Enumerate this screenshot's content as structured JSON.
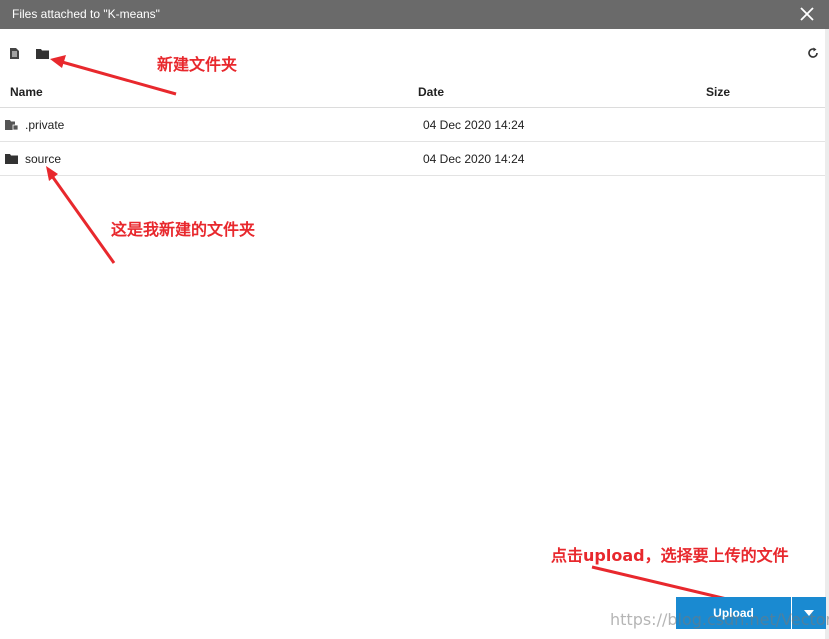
{
  "dialog": {
    "title": "Files attached to \"K-means\""
  },
  "toolbar": {
    "new_file_icon": "new-file-icon",
    "new_folder_icon": "new-folder-icon",
    "refresh_icon": "refresh-icon"
  },
  "table": {
    "columns": [
      "Name",
      "Date",
      "Size"
    ],
    "rows": [
      {
        "name": ".private",
        "date": "04 Dec 2020 14:24",
        "size": "",
        "icon": "locked-folder-icon"
      },
      {
        "name": "source",
        "date": "04 Dec 2020 14:24",
        "size": "",
        "icon": "folder-icon"
      }
    ]
  },
  "annotations": {
    "new_folder": "新建文件夹",
    "my_folder": "这是我新建的文件夹",
    "upload_hint": "点击upload，选择要上传的文件"
  },
  "footer": {
    "upload_label": "Upload"
  },
  "watermark": "https://blog.csdn.net/Vector97",
  "colors": {
    "titlebar": "#6a6a6a",
    "annotation": "#e8282d",
    "upload_button": "#1a8ad1"
  }
}
